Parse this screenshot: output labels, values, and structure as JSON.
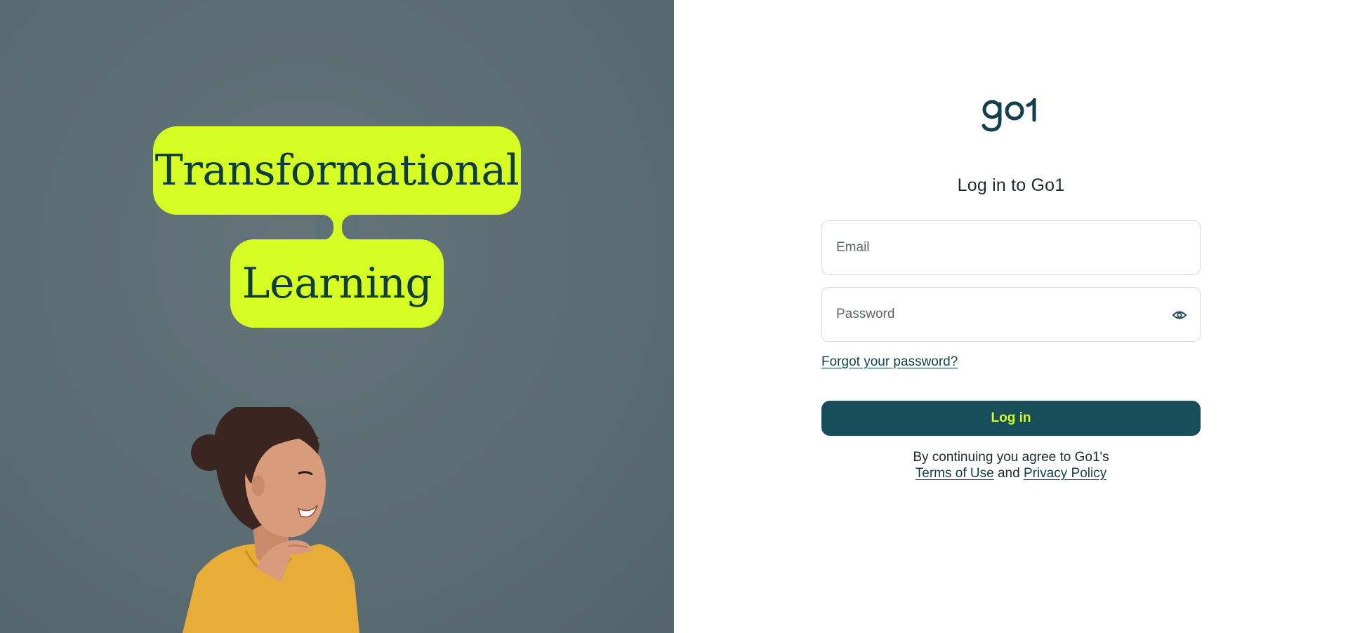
{
  "hero": {
    "bubble_top": "Transformational",
    "bubble_bottom": "Learning"
  },
  "brand": {
    "logo_text": "go1",
    "accent": "#d6fd23",
    "primary": "#184e5a"
  },
  "form": {
    "title": "Log in to Go1",
    "email_placeholder": "Email",
    "password_placeholder": "Password",
    "password_toggle_icon": "eye-icon",
    "forgot_link": "Forgot your password?",
    "submit_label": "Log in"
  },
  "legal": {
    "prefix": "By continuing you agree to Go1's",
    "terms_label": "Terms of Use",
    "conjunction": "and",
    "privacy_label": "Privacy Policy"
  }
}
